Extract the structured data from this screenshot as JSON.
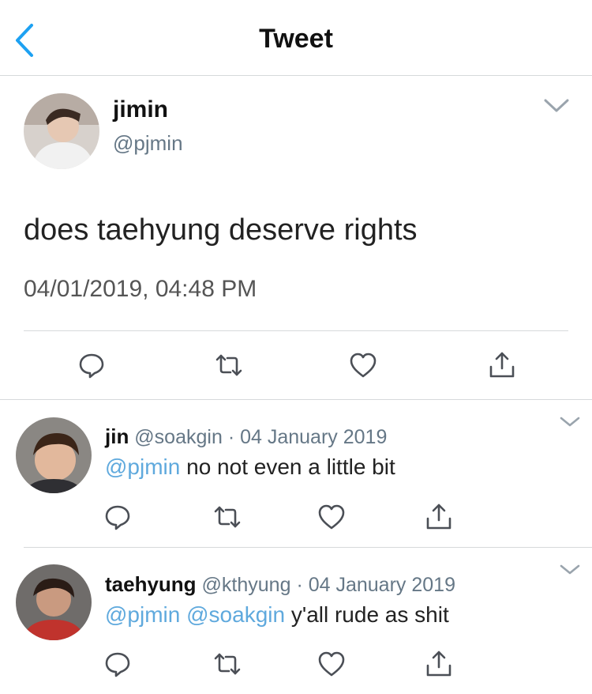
{
  "header": {
    "title": "Tweet"
  },
  "main_tweet": {
    "name": "jimin",
    "handle": "@pjmin",
    "text": "does taehyung deserve rights",
    "timestamp": "04/01/2019, 04:48 PM"
  },
  "replies": [
    {
      "name": "jin",
      "handle": "@soakgin",
      "dot": "·",
      "date": "04 January 2019",
      "mentions": [
        "@pjmin"
      ],
      "text": "no not even a little bit"
    },
    {
      "name": "taehyung",
      "handle": "@kthyung",
      "dot": "·",
      "date": "04 January 2019",
      "mentions": [
        "@pjmin",
        "@soakgin"
      ],
      "text": "y'all rude as shit"
    }
  ],
  "icons": {
    "back": "chevron-left-icon",
    "more": "chevron-down-icon",
    "reply": "reply-icon",
    "retweet": "retweet-icon",
    "like": "heart-icon",
    "share": "share-icon"
  },
  "colors": {
    "accent": "#1da1f2",
    "link": "#5fa9dd",
    "muted": "#657786",
    "divider": "#d6d9db"
  }
}
